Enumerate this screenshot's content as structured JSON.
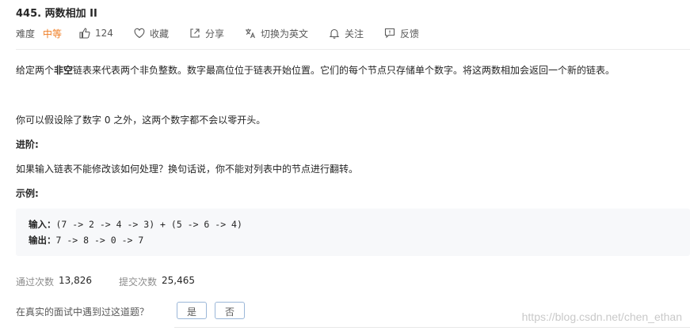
{
  "problem": {
    "title": "445. 两数相加 II",
    "difficulty_label": "难度",
    "difficulty": "中等",
    "difficulty_color": "#ef7c22",
    "likes": "124",
    "favorite": "收藏",
    "share": "分享",
    "translate": "切换为英文",
    "follow": "关注",
    "feedback": "反馈"
  },
  "description": {
    "p1_before": "给定两个",
    "p1_bold": "非空",
    "p1_after": "链表来代表两个非负整数。数字最高位位于链表开始位置。它们的每个节点只存储单个数字。将这两数相加会返回一个新的链表。",
    "p2": "你可以假设除了数字 0 之外，这两个数字都不会以零开头。",
    "advanced_heading": "进阶:",
    "p3": "如果输入链表不能修改该如何处理？换句话说，你不能对列表中的节点进行翻转。",
    "example_heading": "示例:"
  },
  "example": {
    "input_label": "输入：",
    "input_value": "(7 -> 2 -> 4 -> 3) + (5 -> 6 -> 4)",
    "output_label": "输出：",
    "output_value": "7 -> 8 -> 0 -> 7"
  },
  "stats": {
    "accepted_label": "通过次数",
    "accepted_value": "13,826",
    "submissions_label": "提交次数",
    "submissions_value": "25,465"
  },
  "interview": {
    "question": "在真实的面试中遇到过这道题？",
    "yes": "是",
    "no": "否"
  },
  "watermark": "https://blog.csdn.net/chen_ethan"
}
